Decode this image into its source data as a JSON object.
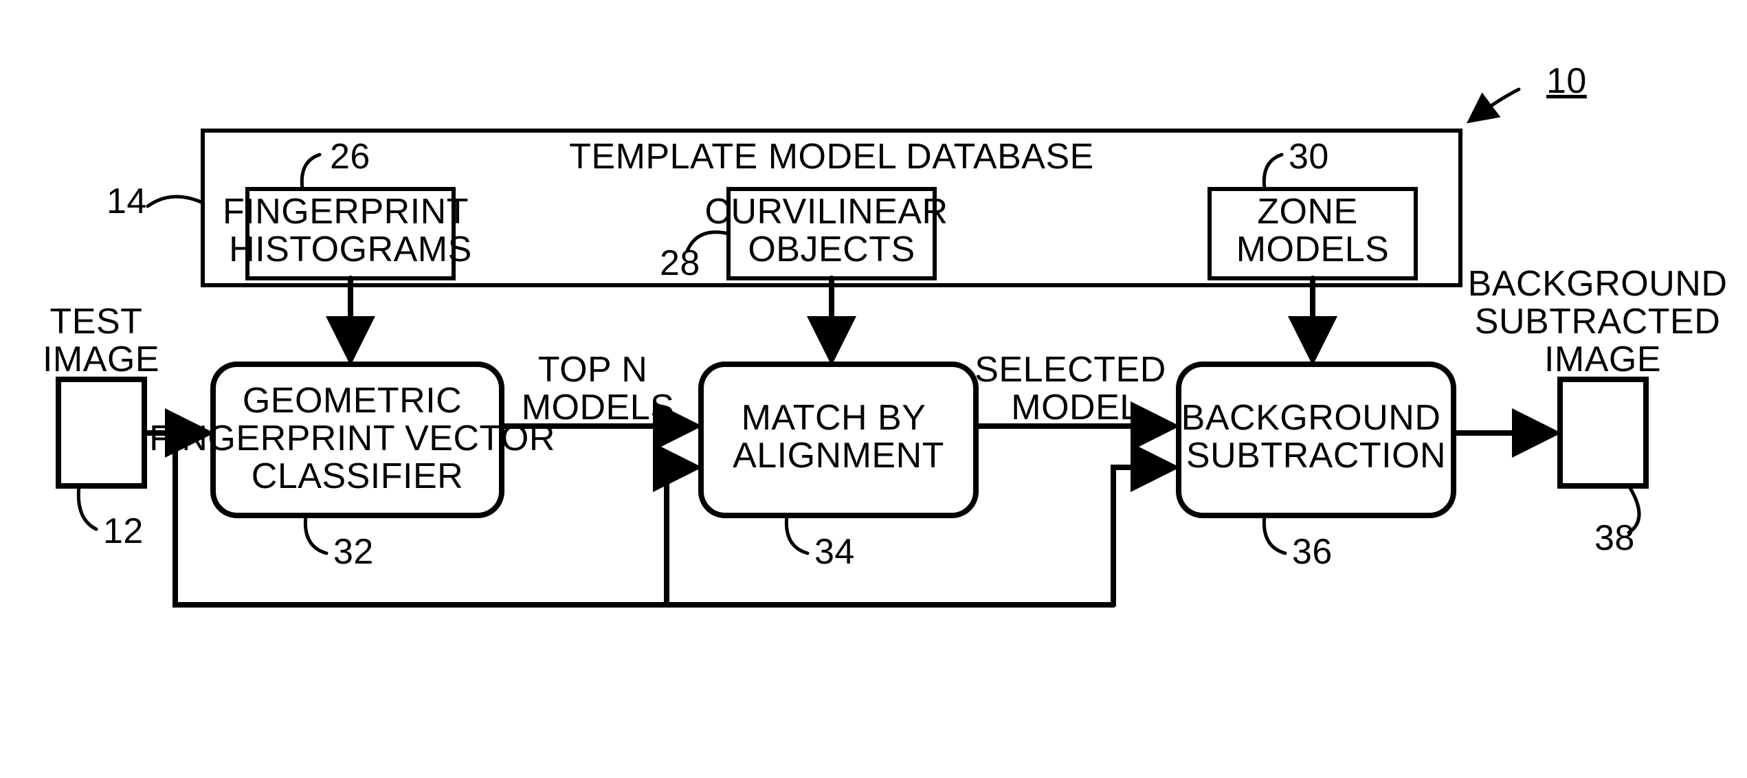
{
  "diagram_ref": {
    "label": "10"
  },
  "database": {
    "title": "TEMPLATE MODEL DATABASE",
    "ref": "14",
    "items": {
      "fingerprint": {
        "label": "FINGERPRINT\nHISTOGRAMS",
        "ref": "26"
      },
      "curvilinear": {
        "label": "CURVILINEAR\nOBJECTS",
        "ref": "28"
      },
      "zone": {
        "label": "ZONE\nMODELS",
        "ref": "30"
      }
    }
  },
  "input": {
    "label": "TEST\nIMAGE",
    "ref": "12"
  },
  "output": {
    "label": "BACKGROUND\nSUBTRACTED\nIMAGE",
    "ref": "38"
  },
  "stages": {
    "classifier": {
      "label": "GEOMETRIC\nFINGERPRINT VECTOR\nCLASSIFIER",
      "ref": "32"
    },
    "match": {
      "label": "MATCH BY\nALIGNMENT",
      "ref": "34"
    },
    "subtract": {
      "label": "BACKGROUND\nSUBTRACTION",
      "ref": "36"
    }
  },
  "edges": {
    "top_n": "TOP N\nMODELS",
    "selected": "SELECTED\nMODEL"
  }
}
